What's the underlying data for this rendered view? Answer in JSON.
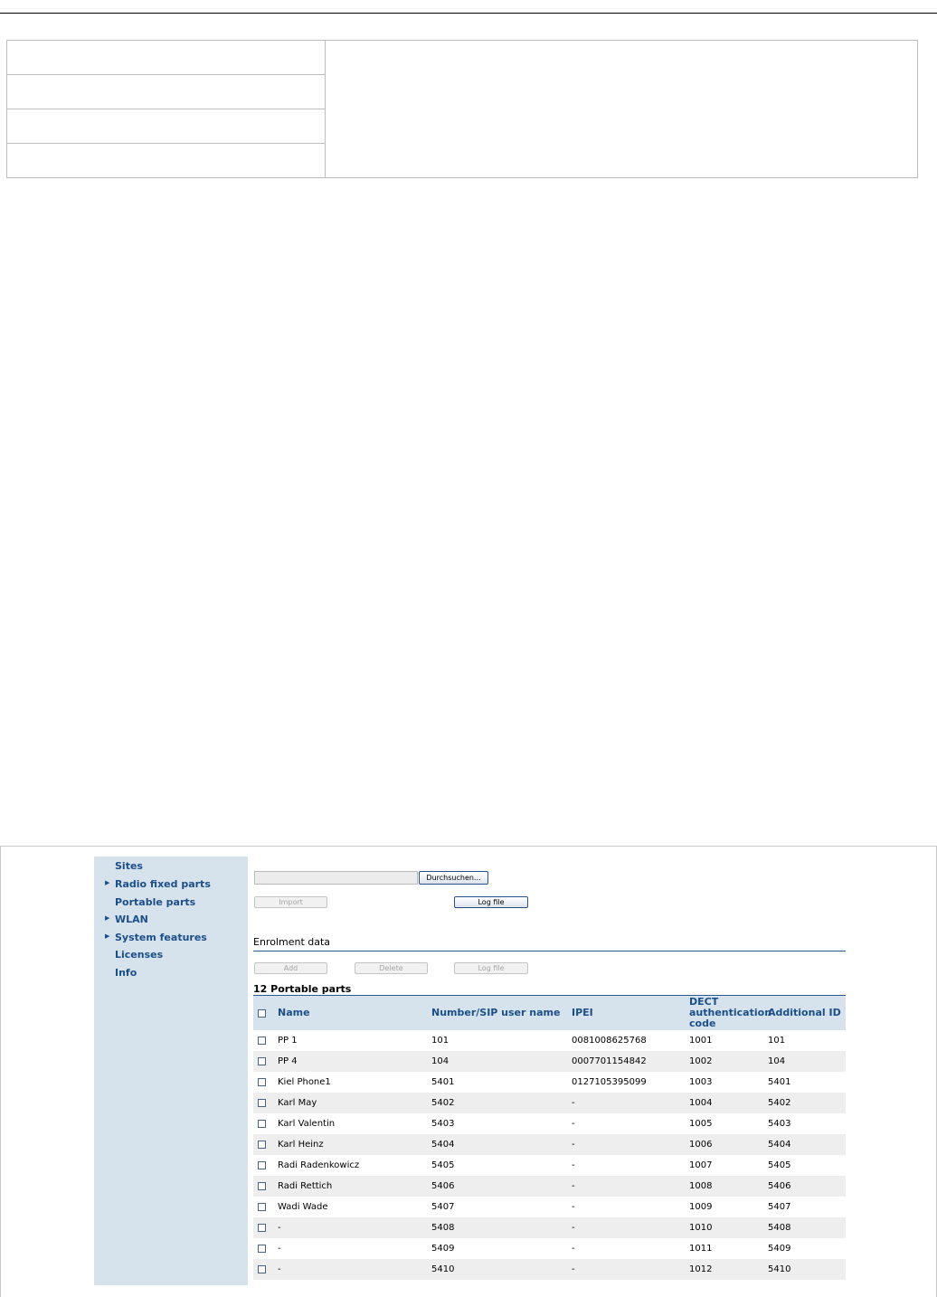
{
  "sidebar": {
    "items": [
      {
        "label": "Sites",
        "expandable": false
      },
      {
        "label": "Radio fixed parts",
        "expandable": true
      },
      {
        "label": "Portable parts",
        "expandable": false
      },
      {
        "label": "WLAN",
        "expandable": true
      },
      {
        "label": "System features",
        "expandable": true
      },
      {
        "label": "Licenses",
        "expandable": false
      },
      {
        "label": "Info",
        "expandable": false
      }
    ]
  },
  "import_section": {
    "browse_label": "Durchsuchen...",
    "import_label": "Import",
    "log_file_label": "Log file"
  },
  "enrolment": {
    "title": "Enrolment data",
    "add_label": "Add",
    "delete_label": "Delete",
    "log_file_label": "Log file"
  },
  "portable_parts": {
    "title": "12 Portable parts",
    "columns": [
      "Name",
      "Number/SIP user name",
      "IPEI",
      "DECT authentication code",
      "Additional ID"
    ],
    "rows": [
      [
        "PP 1",
        "101",
        "0081008625768",
        "1001",
        "101"
      ],
      [
        "PP 4",
        "104",
        "0007701154842",
        "1002",
        "104"
      ],
      [
        "Kiel Phone1",
        "5401",
        "0127105395099",
        "1003",
        "5401"
      ],
      [
        "Karl May",
        "5402",
        "-",
        "1004",
        "5402"
      ],
      [
        "Karl Valentin",
        "5403",
        "-",
        "1005",
        "5403"
      ],
      [
        "Karl Heinz",
        "5404",
        "-",
        "1006",
        "5404"
      ],
      [
        "Radi Radenkowicz",
        "5405",
        "-",
        "1007",
        "5405"
      ],
      [
        "Radi Rettich",
        "5406",
        "-",
        "1008",
        "5406"
      ],
      [
        "Wadi Wade",
        "5407",
        "-",
        "1009",
        "5407"
      ],
      [
        "-",
        "5408",
        "-",
        "1010",
        "5408"
      ],
      [
        "-",
        "5409",
        "-",
        "1011",
        "5409"
      ],
      [
        "-",
        "5410",
        "-",
        "1012",
        "5410"
      ]
    ]
  },
  "colors": {
    "sidebar_bg": "#d7e3ec",
    "link": "#1a4f8b",
    "rule": "#2a5b93",
    "row_alt": "#eeeeee"
  }
}
